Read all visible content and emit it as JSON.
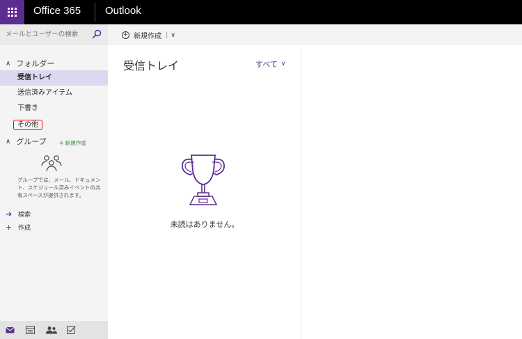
{
  "topbar": {
    "brand": "Office 365",
    "app": "Outlook"
  },
  "search": {
    "placeholder": "メールとユーザーの検索"
  },
  "folders": {
    "header": "フォルダー",
    "items": [
      {
        "label": "受信トレイ",
        "selected": true
      },
      {
        "label": "送信済みアイテム"
      },
      {
        "label": "下書き"
      },
      {
        "label": "その他",
        "highlighted": true
      }
    ]
  },
  "groups": {
    "header": "グループ",
    "new_label": "新規作成",
    "description": "グループでは、メール、ドキュメント、スケジュール済みイベントの共有スペースが提供されます。"
  },
  "actions": [
    {
      "label": "検索",
      "icon": "arrow-right-icon"
    },
    {
      "label": "作成",
      "icon": "plus-icon"
    }
  ],
  "commandbar": {
    "new_label": "新規作成",
    "separator": "|"
  },
  "list": {
    "title": "受信トレイ",
    "filter": "すべて",
    "empty_message": "未読はありません。"
  },
  "colors": {
    "accent": "#5c2d91",
    "topbar": "#000000",
    "selection": "#dcd8f0",
    "highlight_box": "#e00000",
    "new_group": "#2a8b3a"
  }
}
